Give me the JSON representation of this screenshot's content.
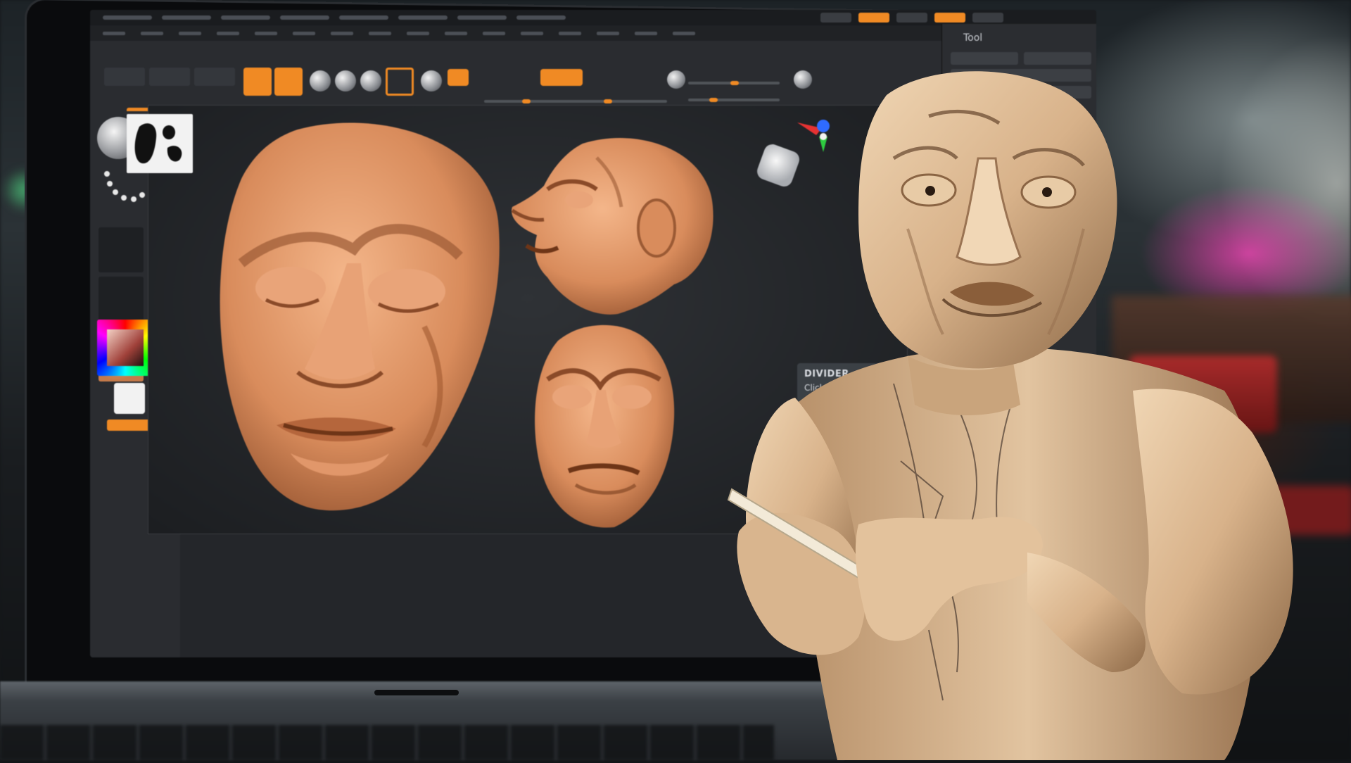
{
  "scene": {
    "description_hidden": ""
  },
  "app": {
    "menu_items": [
      "",
      "",
      "",
      "",
      "",
      "",
      "",
      "",
      "",
      "",
      "",
      "",
      ""
    ],
    "top_right_buttons": [
      "",
      "",
      ""
    ],
    "tool_panel_title": "Tool",
    "tool_panel_rows": [
      "",
      "",
      "",
      ""
    ]
  },
  "tooltip": {
    "title": "DIVIDER",
    "body": "Click to restore previous"
  },
  "colors": {
    "accent": "#f08a24",
    "clay": "#d9946a",
    "wood": "#d6b48c",
    "ui_bg": "#2a2c30"
  },
  "icons": {
    "alpha": "alpha-stencil-icon",
    "gizmo": "axis-gizmo-icon",
    "cube": "navigation-cube-icon"
  }
}
